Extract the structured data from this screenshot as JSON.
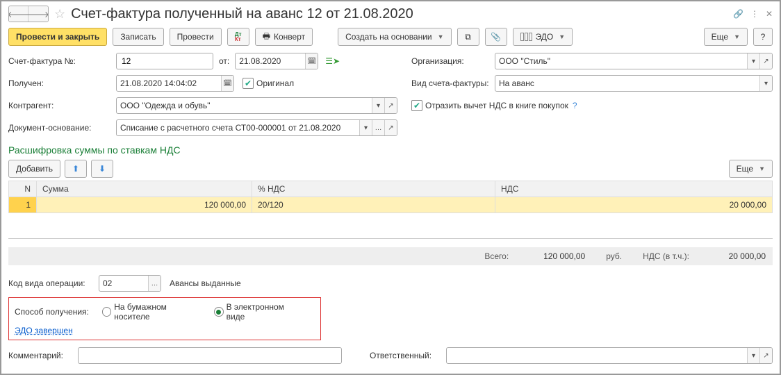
{
  "title": "Счет-фактура полученный на аванс 12 от 21.08.2020",
  "toolbar": {
    "post_close": "Провести и закрыть",
    "save": "Записать",
    "post": "Провести",
    "convert": "Конверт",
    "create_based": "Создать на основании",
    "edo": "ЭДО",
    "more": "Еще",
    "help": "?"
  },
  "fields": {
    "number_label": "Счет-фактура №:",
    "number": "12",
    "from_label": "от:",
    "from": "21.08.2020",
    "received_label": "Получен:",
    "received": "21.08.2020 14:04:02",
    "original": "Оригинал",
    "counterparty_label": "Контрагент:",
    "counterparty": "ООО \"Одежда и обувь\"",
    "basis_label": "Документ-основание:",
    "basis": "Списание с расчетного счета СТ00-000001 от 21.08.2020",
    "org_label": "Организация:",
    "org": "ООО \"Стиль\"",
    "type_label": "Вид счета-фактуры:",
    "type": "На аванс",
    "reflect_vat": "Отразить вычет НДС в книге покупок"
  },
  "section_title": "Расшифровка суммы по ставкам НДС",
  "table_toolbar": {
    "add": "Добавить",
    "more": "Еще"
  },
  "table": {
    "cols": {
      "n": "N",
      "sum": "Сумма",
      "rate": "% НДС",
      "vat": "НДС"
    },
    "row": {
      "n": "1",
      "sum": "120 000,00",
      "rate": "20/120",
      "vat": "20 000,00"
    }
  },
  "totals": {
    "total_label": "Всего:",
    "total": "120 000,00",
    "currency": "руб.",
    "vat_label": "НДС (в т.ч.):",
    "vat": "20 000,00"
  },
  "op_code_label": "Код вида операции:",
  "op_code_val": "02",
  "op_code_desc": "Авансы выданные",
  "delivery": {
    "label": "Способ получения:",
    "paper": "На бумажном носителе",
    "electronic": "В электронном виде",
    "edo_done": "ЭДО завершен"
  },
  "footer": {
    "comment_label": "Комментарий:",
    "responsible_label": "Ответственный:"
  }
}
